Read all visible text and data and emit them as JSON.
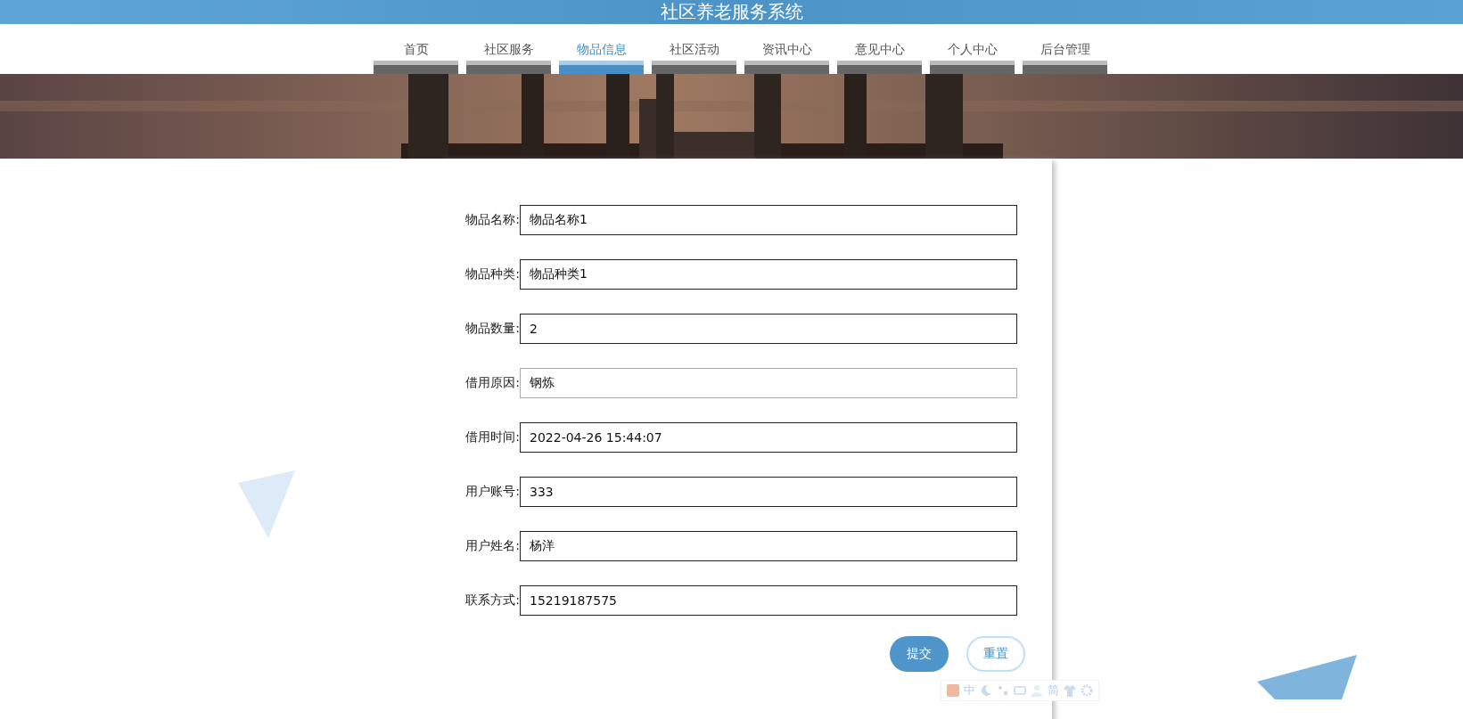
{
  "header": {
    "title": "社区养老服务系统"
  },
  "nav": [
    {
      "label": "首页",
      "selected": false
    },
    {
      "label": "社区服务",
      "selected": false
    },
    {
      "label": "物品信息",
      "selected": true
    },
    {
      "label": "社区活动",
      "selected": false
    },
    {
      "label": "资讯中心",
      "selected": false
    },
    {
      "label": "意见中心",
      "selected": false
    },
    {
      "label": "个人中心",
      "selected": false
    },
    {
      "label": "后台管理",
      "selected": false
    }
  ],
  "form": {
    "fields": [
      {
        "label": "物品名称:",
        "value": "物品名称1",
        "readonly": false
      },
      {
        "label": "物品种类:",
        "value": "物品种类1",
        "readonly": false
      },
      {
        "label": "物品数量:",
        "value": "2",
        "readonly": false
      },
      {
        "label": "借用原因:",
        "value": "钢炼",
        "readonly": true
      },
      {
        "label": "借用时间:",
        "value": "2022-04-26 15:44:07",
        "readonly": false
      },
      {
        "label": "用户账号:",
        "value": "333",
        "readonly": false
      },
      {
        "label": "用户姓名:",
        "value": "杨洋",
        "readonly": false
      },
      {
        "label": "联系方式:",
        "value": "15219187575",
        "readonly": false
      }
    ],
    "buttons": [
      {
        "label": "提交",
        "kind": "primary"
      },
      {
        "label": "重置",
        "kind": "secondary"
      }
    ]
  },
  "ime_toolbar": {
    "language": "中",
    "script": "简"
  }
}
